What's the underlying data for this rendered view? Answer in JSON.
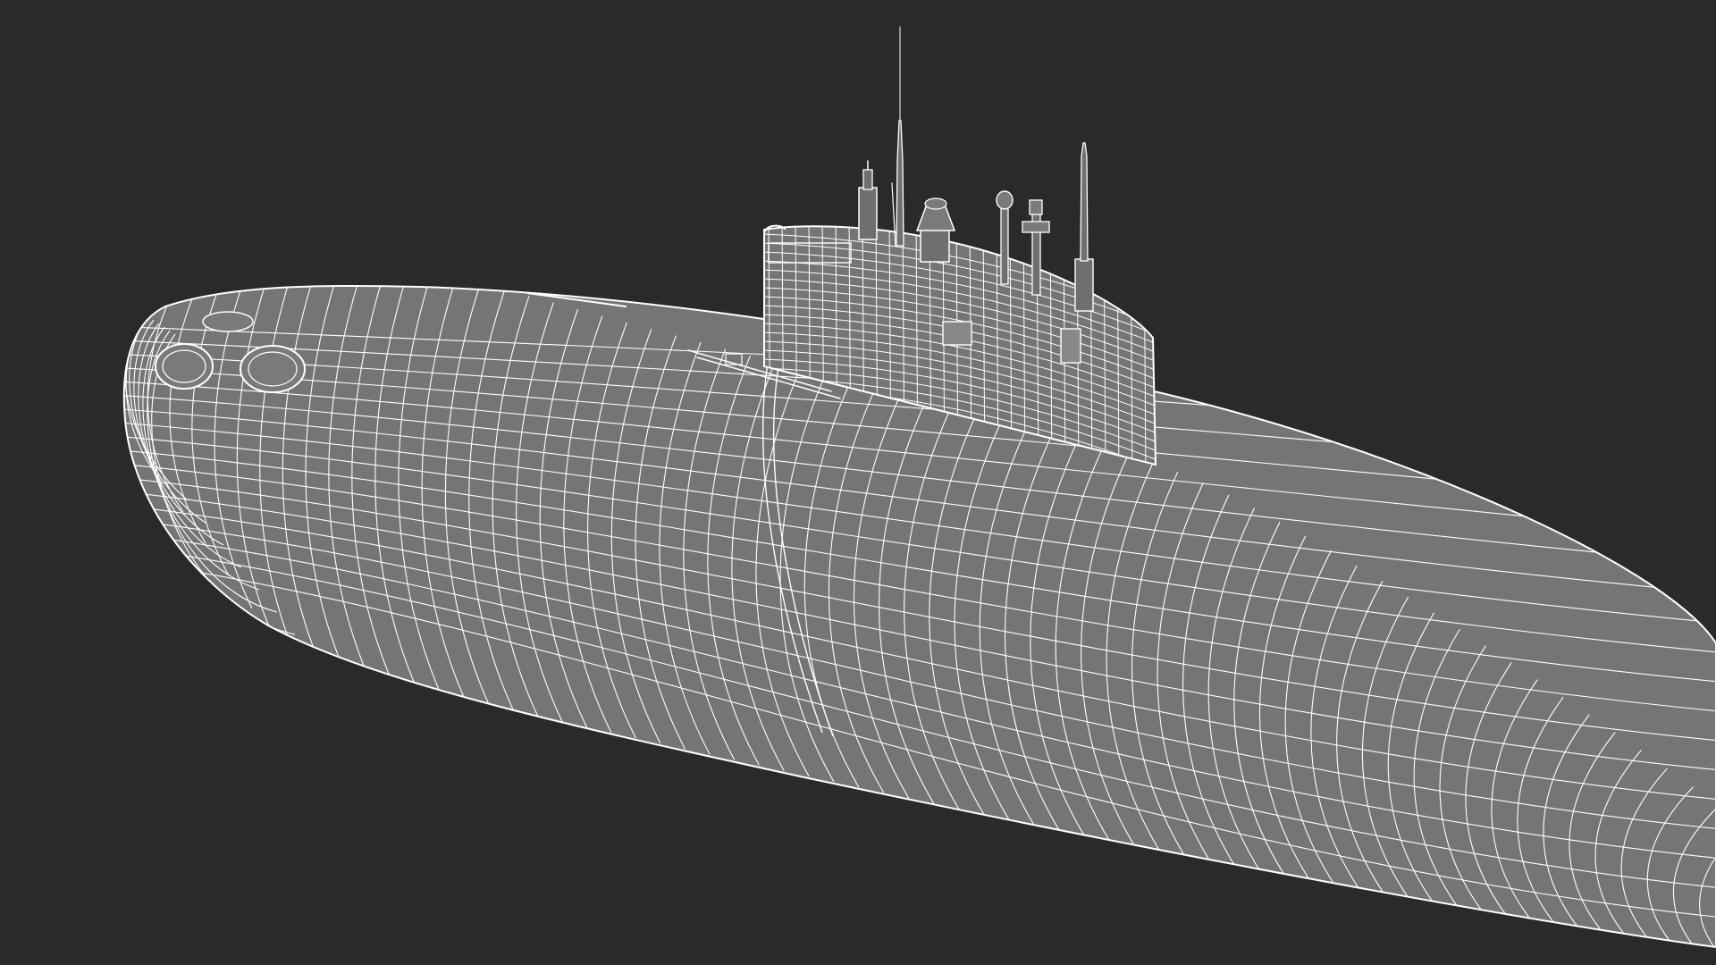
{
  "scene": {
    "subject": "submarine-wireframe",
    "colors": {
      "background": "#2a2a2a",
      "hull_fill": "#757575",
      "wire": "#ffffff"
    },
    "render_mode": "wireframe"
  }
}
